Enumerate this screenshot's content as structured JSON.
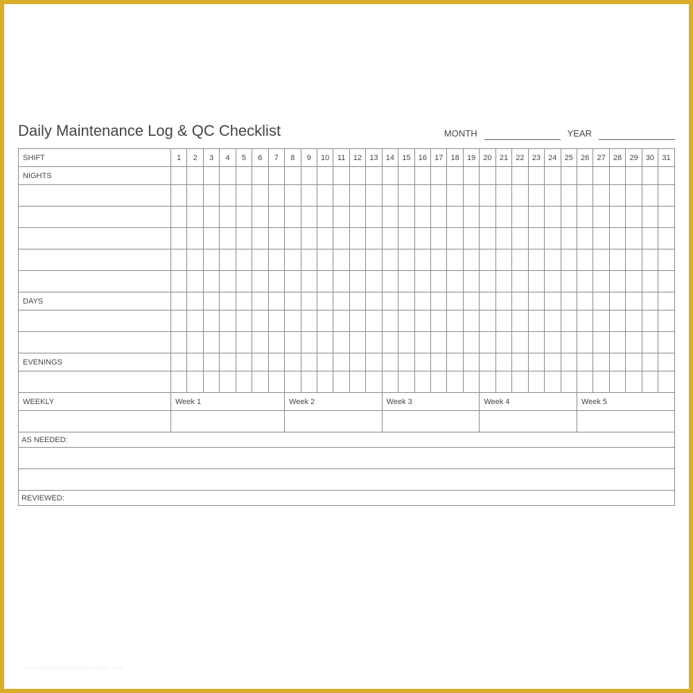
{
  "title": "Daily Maintenance Log & QC Checklist",
  "month_label": "MONTH",
  "year_label": "YEAR",
  "headers": {
    "shift": "SHIFT",
    "days": [
      "1",
      "2",
      "3",
      "4",
      "5",
      "6",
      "7",
      "8",
      "9",
      "10",
      "11",
      "12",
      "13",
      "14",
      "15",
      "16",
      "17",
      "18",
      "19",
      "20",
      "21",
      "22",
      "23",
      "24",
      "25",
      "26",
      "27",
      "28",
      "29",
      "30",
      "31"
    ]
  },
  "sections": {
    "nights": "NIGHTS",
    "days": "DAYS",
    "evenings": "EVENINGS",
    "weekly": "WEEKLY",
    "weeks": [
      "Week 1",
      "Week 2",
      "Week 3",
      "Week 4",
      "Week 5"
    ],
    "as_needed": "AS NEEDED:",
    "reviewed": "REVIEWED:"
  },
  "watermark": "www.heritagechristiancollege.com"
}
